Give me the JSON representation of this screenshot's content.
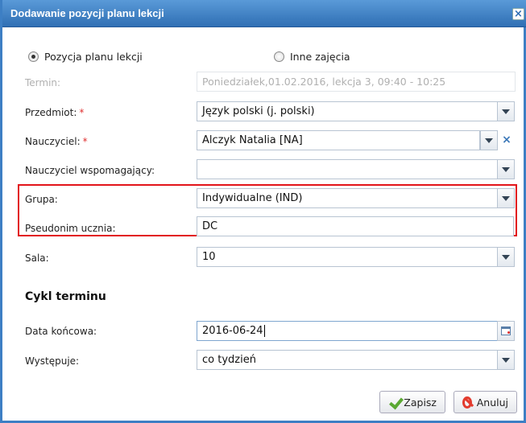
{
  "dialog": {
    "title": "Dodawanie pozycji planu lekcji",
    "close_icon": "close-icon"
  },
  "radio": {
    "option1": {
      "label": "Pozycja planu lekcji",
      "selected": true
    },
    "option2": {
      "label": "Inne zajęcia",
      "selected": false
    }
  },
  "fields": {
    "termin": {
      "label": "Termin:",
      "value": "Poniedziałek,01.02.2016, lekcja 3, 09:40 - 10:25"
    },
    "przedmiot": {
      "label": "Przedmiot:",
      "required": "*",
      "value": "Język polski (j. polski)"
    },
    "nauczyciel": {
      "label": "Nauczyciel:",
      "required": "*",
      "value": "Alczyk Natalia [NA]"
    },
    "wspomagajacy": {
      "label": "Nauczyciel wspomagający:",
      "value": ""
    },
    "grupa": {
      "label": "Grupa:",
      "value": "Indywidualne (IND)"
    },
    "pseudonim": {
      "label": "Pseudonim ucznia:",
      "value": "DC"
    },
    "sala": {
      "label": "Sala:",
      "value": "10"
    }
  },
  "cykl": {
    "heading": "Cykl terminu",
    "data_koncowa": {
      "label": "Data końcowa:",
      "value": "2016-06-24"
    },
    "wystepuje": {
      "label": "Występuje:",
      "value": "co tydzień"
    }
  },
  "buttons": {
    "save": "Zapisz",
    "cancel": "Anuluj"
  },
  "colors": {
    "title_bar": "#3d7fc4",
    "highlight": "#e2141a",
    "required": "#e03030"
  }
}
